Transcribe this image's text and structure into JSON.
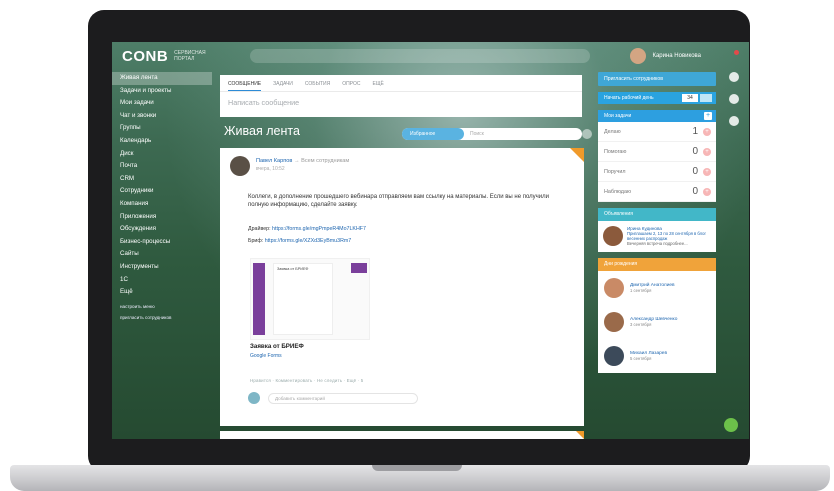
{
  "app": {
    "logo": "CONB",
    "logo_sub": "СЕРВИСНАЯ ПОРТАЛ",
    "user_name": "Карина Новикова"
  },
  "sidebar": {
    "items": [
      {
        "label": "Живая лента",
        "active": true
      },
      {
        "label": "Задачи и проекты"
      },
      {
        "label": "Мои задачи"
      },
      {
        "label": "Чат и звонки"
      },
      {
        "label": "Группы"
      },
      {
        "label": "Календарь"
      },
      {
        "label": "Диск"
      },
      {
        "label": "Почта"
      },
      {
        "label": "CRM"
      },
      {
        "label": "Сотрудники"
      },
      {
        "label": "Компания"
      },
      {
        "label": "Приложения"
      },
      {
        "label": "Обсуждения"
      },
      {
        "label": "Бизнес-процессы"
      },
      {
        "label": "Сайты"
      },
      {
        "label": "Инструменты"
      },
      {
        "label": "1С"
      },
      {
        "label": "Ещё"
      }
    ],
    "footer": [
      "настроить меню",
      "пригласить сотрудников"
    ]
  },
  "composer": {
    "tabs": [
      "Сообщение",
      "Задачи",
      "События",
      "Опрос",
      "Ещё"
    ],
    "placeholder": "Написать сообщение"
  },
  "feed": {
    "title": "Живая лента",
    "filter_chip": "Избранное",
    "filter_placeholder": "Поиск"
  },
  "post": {
    "author": "Павел Карпов",
    "recipient": "Всем сотрудникам",
    "date": "вчера, 10:52",
    "text": "Коллеги, в дополнение прошедшего вебинара отправляем вам ссылку на материалы. Если вы не получили полную информацию, сделайте заявку.",
    "link1_label": "Драйвер:",
    "link1_url": "https://forms.gle/mgPmpeR4Mo7LKHF7",
    "link2_label": "Бриф:",
    "link2_url": "https://forms.gle/XZXd3EyBmu3Rm7",
    "preview_title": "Заявка от БРИЕФ",
    "preview_site": "Google Forms",
    "preview_page_title": "Заявка от БРИЕФ",
    "actions": "Нравится · Комментировать · Не следить · Ещё · 5",
    "comment_placeholder": "Добавить комментарий"
  },
  "right": {
    "invite_button": "Пригласить сотрудников",
    "work_time": "Начать рабочий день",
    "work_count": "34",
    "tasks_title": "Мои задачи",
    "tasks": [
      {
        "label": "Делаю",
        "count": "1"
      },
      {
        "label": "Помогаю",
        "count": "0"
      },
      {
        "label": "Поручил",
        "count": "0"
      },
      {
        "label": "Наблюдаю",
        "count": "0"
      }
    ],
    "news_title": "Объявления",
    "news_author": "Ирина Кудинова",
    "news_text": "Приглашаем 2, 13 по 28 сентября в блог весенних распродаж",
    "news_more": "Вечерняя встреча подробнее...",
    "bdays_title": "Дни рождения",
    "bdays": [
      {
        "name": "Дмитрий Анатолиев",
        "date": "1 сентября",
        "color": "#c98a66"
      },
      {
        "name": "Александр Шевченко",
        "date": "3 сентября",
        "color": "#9a6a4a"
      },
      {
        "name": "Михаил Лазарев",
        "date": "5 сентября",
        "color": "#3c4a5a"
      }
    ]
  }
}
